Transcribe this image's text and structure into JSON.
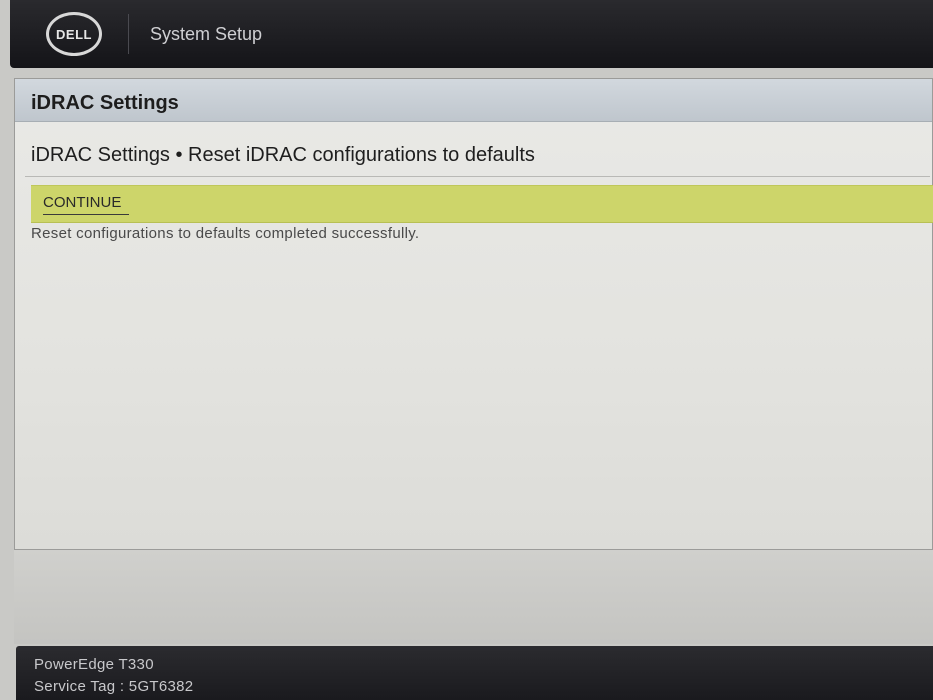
{
  "header": {
    "logo_text": "DELL",
    "app_title": "System Setup"
  },
  "panel": {
    "title": "iDRAC Settings",
    "breadcrumb": "iDRAC Settings • Reset iDRAC configurations to defaults",
    "continue_label": "CONTINUE",
    "status_message": "Reset configurations to defaults completed successfully."
  },
  "footer": {
    "model": "PowerEdge T330",
    "service_tag": "Service Tag : 5GT6382"
  },
  "colors": {
    "action_bar": "#cdd56a",
    "header_bg": "#1c1c20",
    "panel_header": "#c8ced4"
  },
  "icons": {
    "logo": "dell-logo"
  }
}
